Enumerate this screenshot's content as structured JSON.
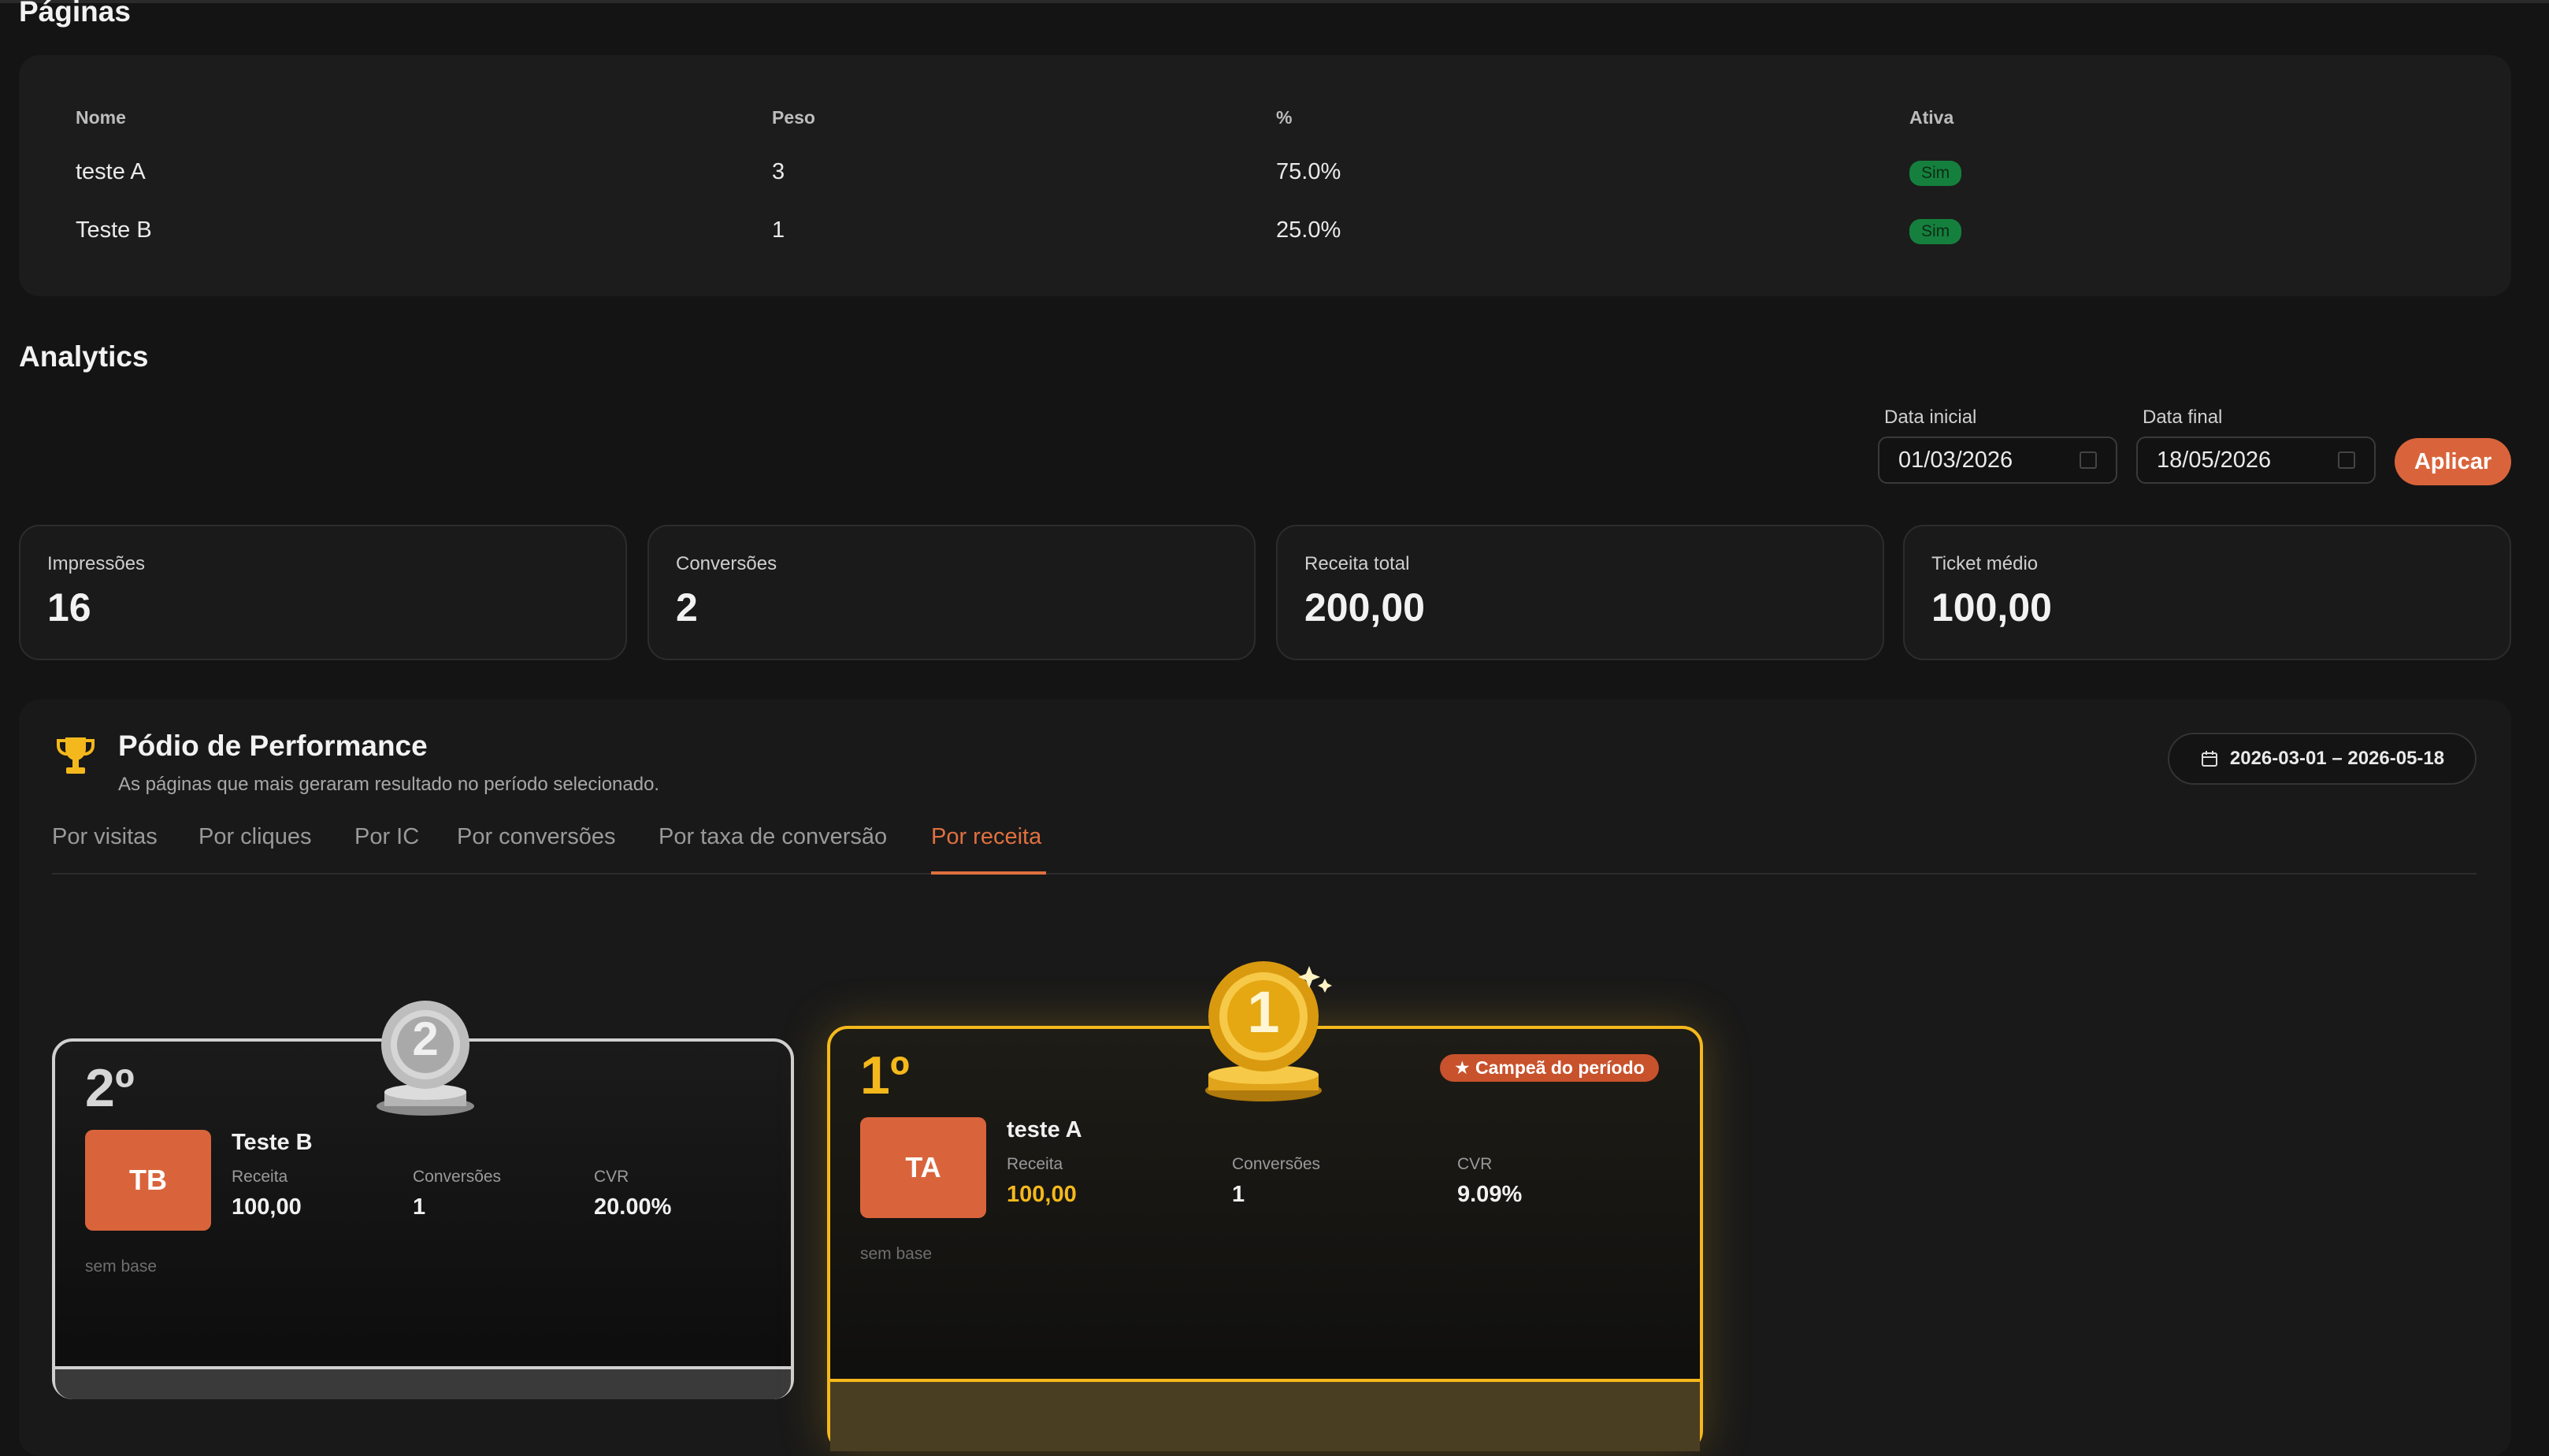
{
  "pages": {
    "title": "Páginas",
    "headers": {
      "name": "Nome",
      "weight": "Peso",
      "percent": "%",
      "active": "Ativa"
    },
    "rows": [
      {
        "name": "teste A",
        "weight": "3",
        "percent": "75.0%",
        "active": "Sim"
      },
      {
        "name": "Teste B",
        "weight": "1",
        "percent": "25.0%",
        "active": "Sim"
      }
    ]
  },
  "analytics": {
    "title": "Analytics",
    "start_label": "Data inicial",
    "start_value": "01/03/2026",
    "end_label": "Data final",
    "end_value": "18/05/2026",
    "apply_label": "Aplicar",
    "stats": [
      {
        "label": "Impressões",
        "value": "16"
      },
      {
        "label": "Conversões",
        "value": "2"
      },
      {
        "label": "Receita total",
        "value": "200,00"
      },
      {
        "label": "Ticket médio",
        "value": "100,00"
      }
    ]
  },
  "podium": {
    "title": "Pódio de Performance",
    "subtitle": "As páginas que mais geraram resultado no período selecionado.",
    "range": "2026-03-01 – 2026-05-18",
    "tabs": [
      "Por visitas",
      "Por cliques",
      "Por IC",
      "Por conversões",
      "Por taxa de conversão",
      "Por receita"
    ],
    "active_tab": "Por receita",
    "champion_badge": "★ Campeã do período",
    "second": {
      "rank": "2º",
      "medal": "2",
      "initials": "TB",
      "name": "Teste B",
      "revenue_label": "Receita",
      "revenue": "100,00",
      "conv_label": "Conversões",
      "conversions": "1",
      "cvr_label": "CVR",
      "cvr": "20.00%",
      "note": "sem base"
    },
    "first": {
      "rank": "1º",
      "medal": "1",
      "initials": "TA",
      "name": "teste A",
      "revenue_label": "Receita",
      "revenue": "100,00",
      "conv_label": "Conversões",
      "conversions": "1",
      "cvr_label": "CVR",
      "cvr": "9.09%",
      "note": "sem base"
    }
  },
  "colors": {
    "accent": "#d9643b",
    "gold": "#f5b81c",
    "silver": "#cfcfcf",
    "success": "#15803d"
  },
  "icons": {
    "trophy": "trophy-icon",
    "calendar": "calendar-icon",
    "star": "star-icon"
  }
}
